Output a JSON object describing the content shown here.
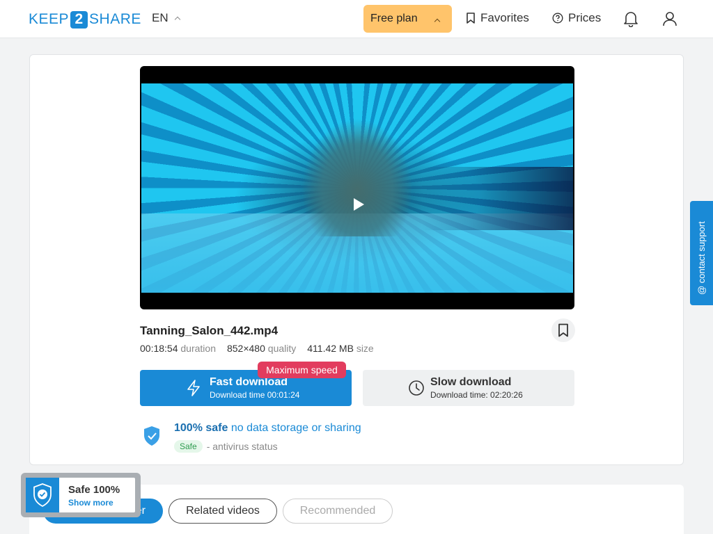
{
  "header": {
    "logo": {
      "left": "KEEP",
      "mid": "2",
      "right": "SHARE"
    },
    "language": "EN",
    "plan": "Free plan",
    "favorites": "Favorites",
    "prices": "Prices"
  },
  "file": {
    "name": "Tanning_Salon_442.mp4",
    "duration_value": "00:18:54",
    "duration_label": "duration",
    "quality_value": "852×480",
    "quality_label": "quality",
    "size_value": "411.42 MB",
    "size_label": "size"
  },
  "download": {
    "fast_title": "Fast download",
    "fast_sub": "Download time 00:01:24",
    "badge": "Maximum speed",
    "slow_title": "Slow download",
    "slow_sub": "Download time: 02:20:26"
  },
  "safety": {
    "strong": "100% safe",
    "light": "no data storage or sharing",
    "badge": "Safe",
    "status": "- antivirus status"
  },
  "support": {
    "label": "@ contact support"
  },
  "tabs": {
    "partner": "From this partner",
    "related": "Related videos",
    "recommended": "Recommended"
  },
  "safe_widget": {
    "title": "Safe 100%",
    "link": "Show more"
  },
  "colors": {
    "accent": "#1a8ad6",
    "plan": "#ffc46b",
    "badge": "#e23c5e"
  }
}
